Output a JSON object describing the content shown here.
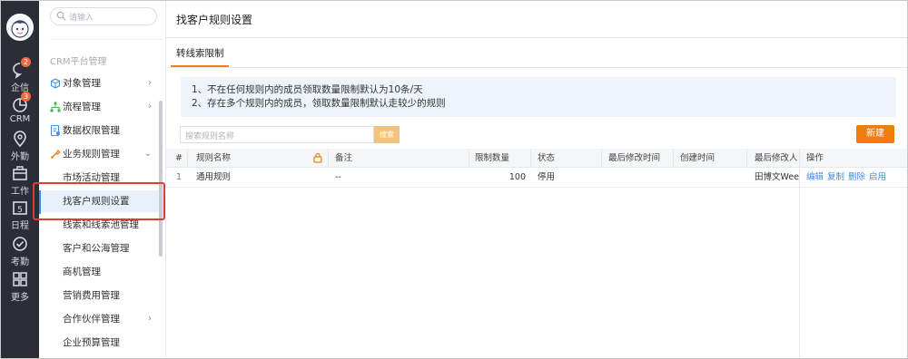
{
  "app": {
    "nav": {
      "items": [
        {
          "label": "企信",
          "icon": "chat-icon",
          "badge": "2"
        },
        {
          "label": "CRM",
          "icon": "crm-chart-icon",
          "badge": "3"
        },
        {
          "label": "外勤",
          "icon": "location-icon"
        },
        {
          "label": "工作",
          "icon": "briefcase-icon"
        },
        {
          "label": "日程",
          "icon": "calendar-icon",
          "day": "5"
        },
        {
          "label": "考勤",
          "icon": "check-circle-icon"
        },
        {
          "label": "更多",
          "icon": "grid-icon"
        }
      ]
    }
  },
  "menu": {
    "search_placeholder": "请输入",
    "group_title": "CRM平台管理",
    "items": [
      {
        "label": "对象管理",
        "icon": "cube-icon",
        "chevron": "›"
      },
      {
        "label": "流程管理",
        "icon": "flow-icon",
        "chevron": "›"
      },
      {
        "label": "数据权限管理",
        "icon": "data-permission-icon",
        "chevron": ""
      },
      {
        "label": "业务规则管理",
        "icon": "rules-icon",
        "chevron": "⌄"
      }
    ],
    "sub_items": [
      {
        "label": "市场活动管理",
        "chevron": ""
      },
      {
        "label": "找客户规则设置",
        "chevron": "",
        "active": true
      },
      {
        "label": "线索和线索池管理",
        "chevron": ""
      },
      {
        "label": "客户和公海管理",
        "chevron": ""
      },
      {
        "label": "商机管理",
        "chevron": ""
      },
      {
        "label": "营销费用管理",
        "chevron": ""
      },
      {
        "label": "合作伙伴管理",
        "chevron": "›"
      },
      {
        "label": "企业预算管理",
        "chevron": ""
      }
    ]
  },
  "page": {
    "title": "找客户规则设置",
    "tab": "转线索限制",
    "notice_lines": [
      "1、不在任何规则内的成员领取数量限制默认为10条/天",
      "2、存在多个规则内的成员，领取数量限制默认走较少的规则"
    ],
    "search_placeholder": "搜索规则名称",
    "search_button": "搜索",
    "new_button": "新建"
  },
  "table": {
    "columns": [
      "#",
      "规则名称",
      "备注",
      "限制数量",
      "状态",
      "最后修改时间",
      "创建时间",
      "最后修改人",
      "操作"
    ],
    "rows": [
      {
        "index": "1",
        "name": "通用规则",
        "remark": "--",
        "limit": "100",
        "status": "停用",
        "modified_time": "",
        "created_time": "",
        "modifier": "田博文Weeki",
        "ops": [
          "编辑",
          "复制",
          "删除",
          "启用"
        ]
      }
    ]
  },
  "colors": {
    "rail_bg": "#2b2e36",
    "accent_orange": "#f07d0f",
    "link_blue": "#3c8ee6",
    "highlight_red": "#e53935"
  }
}
